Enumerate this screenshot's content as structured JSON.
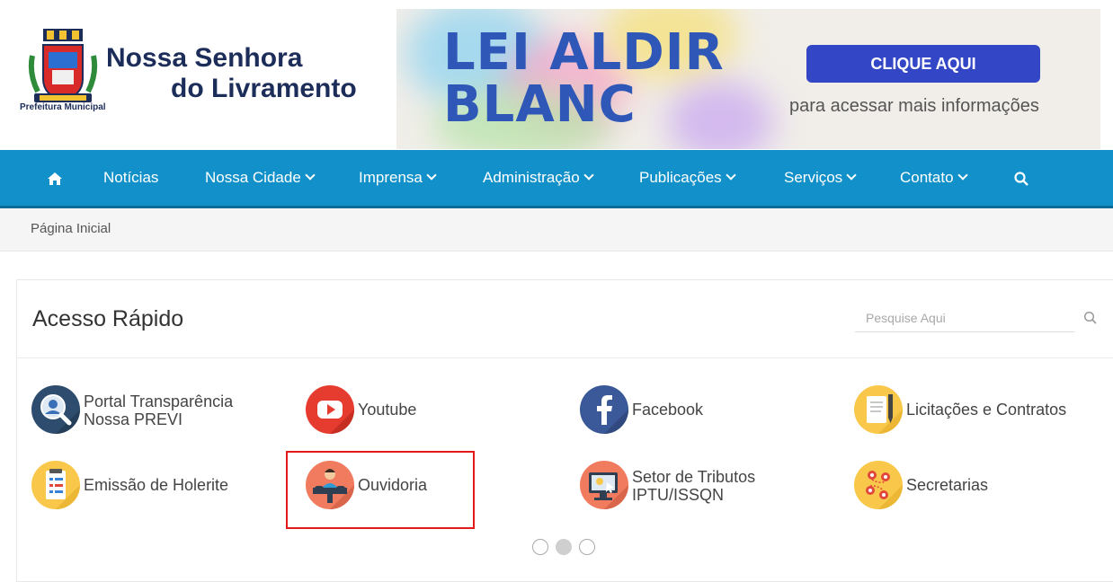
{
  "header": {
    "logo_line1": "Nossa Senhora",
    "logo_line2": "do Livramento",
    "logo_sub": "Prefeitura Municipal",
    "banner_title_line1": "LEI ALDIR",
    "banner_title_line2": "BLANC",
    "banner_button": "CLIQUE AQUI",
    "banner_subtext": "para acessar mais informações"
  },
  "nav": {
    "home_icon": "home-icon",
    "items": [
      {
        "label": "Notícias",
        "dropdown": false
      },
      {
        "label": "Nossa Cidade",
        "dropdown": true
      },
      {
        "label": "Imprensa",
        "dropdown": true
      },
      {
        "label": "Administração",
        "dropdown": true
      },
      {
        "label": "Publicações",
        "dropdown": true
      },
      {
        "label": "Serviços",
        "dropdown": true
      },
      {
        "label": "Contato",
        "dropdown": true
      }
    ],
    "search_icon": "search-icon"
  },
  "breadcrumb": {
    "home": "Página Inicial"
  },
  "quick_access": {
    "title": "Acesso Rápido",
    "search_placeholder": "Pesquise Aqui",
    "links": [
      {
        "line1": "Portal Transparência",
        "line2": "Nossa PREVI",
        "icon": "transparency-portal-icon"
      },
      {
        "line1": "Youtube",
        "line2": "",
        "icon": "youtube-icon"
      },
      {
        "line1": "Facebook",
        "line2": "",
        "icon": "facebook-icon"
      },
      {
        "line1": "Licitações e Contratos",
        "line2": "",
        "icon": "contracts-icon"
      },
      {
        "line1": "Emissão de Holerite",
        "line2": "",
        "icon": "payslip-icon"
      },
      {
        "line1": "Ouvidoria",
        "line2": "",
        "icon": "ombudsman-icon"
      },
      {
        "line1": "Setor de Tributos",
        "line2": "IPTU/ISSQN",
        "icon": "taxes-icon"
      },
      {
        "line1": "Secretarias",
        "line2": "",
        "icon": "departments-icon"
      }
    ],
    "carousel": {
      "pages": 3,
      "active": 1
    }
  },
  "colors": {
    "nav": "#1290c9",
    "banner_blue": "#2f57b7",
    "button": "#3347c6",
    "highlight": "#e31a1a"
  }
}
